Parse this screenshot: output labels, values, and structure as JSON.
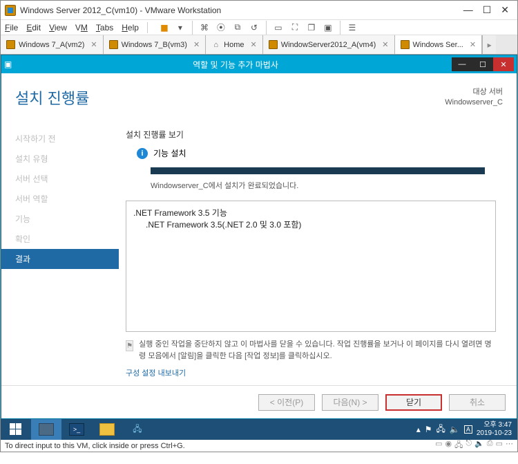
{
  "titlebar": {
    "title": "Windows Server 2012_C(vm10) - VMware Workstation"
  },
  "menubar": {
    "file": "File",
    "edit": "Edit",
    "view": "View",
    "vm": "VM",
    "tabs": "Tabs",
    "help": "Help"
  },
  "tabs": [
    {
      "label": "Windows 7_A(vm2)"
    },
    {
      "label": "Windows 7_B(vm3)"
    },
    {
      "label": "Home"
    },
    {
      "label": "WindowServer2012_A(vm4)"
    },
    {
      "label": "Windows Ser..."
    }
  ],
  "wizard": {
    "title": "역할 및 기능 추가 마법사",
    "heading": "설치 진행률",
    "target_label": "대상 서버",
    "target_value": "Windowserver_C",
    "steps": [
      "시작하기 전",
      "설치 유형",
      "서버 선택",
      "서버 역할",
      "기능",
      "확인",
      "결과"
    ],
    "section_label": "설치 진행률 보기",
    "feature_install": "기능 설치",
    "status_msg": "Windowserver_C에서 설치가 완료되었습니다.",
    "feature_1": ".NET Framework 3.5 기능",
    "feature_1_sub": ".NET Framework 3.5(.NET 2.0 및 3.0 포함)",
    "note": "실행 중인 작업을 중단하지 않고 이 마법사를 닫을 수 있습니다. 작업 진행률을 보거나 이 페이지를 다시 열려면 명령 모음에서 [알림]을 클릭한 다음 [작업 정보]를 클릭하십시오.",
    "link": "구성 설정 내보내기",
    "btn_prev": "< 이전(P)",
    "btn_next": "다음(N) >",
    "btn_close": "닫기",
    "btn_cancel": "취소"
  },
  "taskbar": {
    "time": "오후 3:47",
    "date": "2019-10-23"
  },
  "statusline": {
    "text": "To direct input to this VM, click inside or press Ctrl+G."
  }
}
